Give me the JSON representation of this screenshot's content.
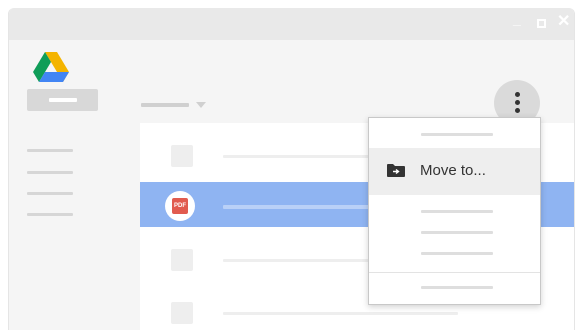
{
  "app": {
    "name": "Google Drive",
    "logo_icon": "google-drive-icon"
  },
  "window_controls": [
    "minimize-icon",
    "maximize-icon",
    "close-icon"
  ],
  "file_list": {
    "selected_file_type": "PDF",
    "selection_color": "#8fb4f2"
  },
  "context_menu": {
    "move_to_label": "Move to...",
    "move_to_icon": "move-folder-icon",
    "trigger_icon": "more-vert-icon"
  },
  "colors": {
    "pdf_red": "#e15b4f",
    "drive_green": "#0f9d58",
    "drive_yellow": "#f4b400",
    "drive_blue": "#4285f4"
  }
}
